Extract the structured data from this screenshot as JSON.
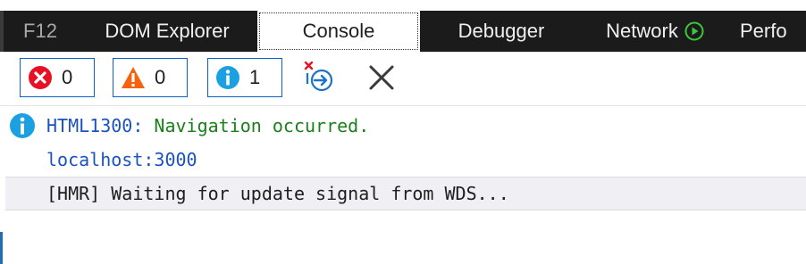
{
  "tabs": {
    "f12": "F12",
    "dom_explorer": "DOM Explorer",
    "console": "Console",
    "debugger": "Debugger",
    "network": "Network",
    "performance": "Perfo"
  },
  "toolbar": {
    "errors_count": "0",
    "warnings_count": "0",
    "info_count": "1"
  },
  "console": {
    "messages": [
      {
        "code": "HTML1300:",
        "text": " Navigation occurred."
      },
      {
        "link": "localhost:3000"
      },
      {
        "text": "[HMR] Waiting for update signal from WDS..."
      }
    ]
  },
  "colors": {
    "tab_bar_bg": "#1b1b1b",
    "error_red": "#e81123",
    "warning_orange": "#f7630c",
    "info_blue": "#1ba1e2",
    "message_green": "#1b7f1b",
    "link_blue": "#1a52c0"
  }
}
